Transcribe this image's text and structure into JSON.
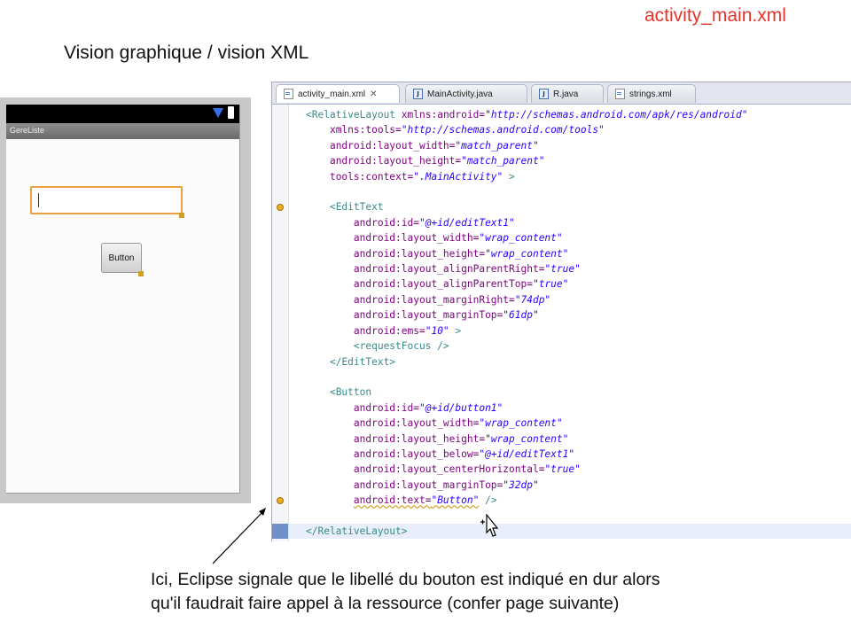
{
  "slide": {
    "corner_title": "activity_main.xml",
    "heading": "Vision graphique / vision XML",
    "caption_line1": "Ici, Eclipse signale que le libellé du bouton est indiqué en dur alors",
    "caption_line2": "qu'il faudrait faire appel à la ressource (confer page suivante)"
  },
  "preview": {
    "app_title": "GereListe",
    "button_label": "Button"
  },
  "editor": {
    "tabs": [
      {
        "label": "activity_main.xml",
        "icon": "xml-file-icon",
        "active": true
      },
      {
        "label": "MainActivity.java",
        "icon": "java-file-icon",
        "active": false
      },
      {
        "label": "R.java",
        "icon": "java-file-icon",
        "active": false
      },
      {
        "label": "strings.xml",
        "icon": "xml-file-icon",
        "active": false
      }
    ],
    "tab_close_glyph": "✕",
    "code": {
      "l1_tag": "<RelativeLayout",
      "l1_attr": "xmlns:android=",
      "l1_val": "\"http://schemas.android.com/apk/res/android\"",
      "l2_attr": "xmlns:tools=",
      "l2_val": "\"http://schemas.android.com/tools\"",
      "l3_attr": "android:layout_width=",
      "l3_val": "\"match_parent\"",
      "l4_attr": "android:layout_height=",
      "l4_val": "\"match_parent\"",
      "l5_attr": "tools:context=",
      "l5_val": "\".MainActivity\"",
      "l5_end": " >",
      "l7_tag": "<EditText",
      "l8_attr": "android:id=",
      "l8_val": "\"@+id/editText1\"",
      "l9_attr": "android:layout_width=",
      "l9_val": "\"wrap_content\"",
      "l10_attr": "android:layout_height=",
      "l10_val": "\"wrap_content\"",
      "l11_attr": "android:layout_alignParentRight=",
      "l11_val": "\"true\"",
      "l12_attr": "android:layout_alignParentTop=",
      "l12_val": "\"true\"",
      "l13_attr": "android:layout_marginRight=",
      "l13_val": "\"74dp\"",
      "l14_attr": "android:layout_marginTop=",
      "l14_val": "\"61dp\"",
      "l15_attr": "android:ems=",
      "l15_val": "\"10\"",
      "l15_end": " >",
      "l16_tag": "<requestFocus />",
      "l17_tag": "</EditText>",
      "l19_tag": "<Button",
      "l20_attr": "android:id=",
      "l20_val": "\"@+id/button1\"",
      "l21_attr": "android:layout_width=",
      "l21_val": "\"wrap_content\"",
      "l22_attr": "android:layout_height=",
      "l22_val": "\"wrap_content\"",
      "l23_attr": "android:layout_below=",
      "l23_val": "\"@+id/editText1\"",
      "l24_attr": "android:layout_centerHorizontal=",
      "l24_val": "\"true\"",
      "l25_attr": "android:layout_marginTop=",
      "l25_val": "\"32dp\"",
      "l26_attr": "android:text=",
      "l26_val": "\"Button\"",
      "l26_end": " />",
      "l28_tag": "</RelativeLayout>"
    }
  },
  "colors": {
    "corner_title": "#e8342a",
    "warning": "#e8b020",
    "xml_tag": "#3a8a8a",
    "xml_attr": "#7f007f",
    "xml_value": "#2a00ff"
  }
}
